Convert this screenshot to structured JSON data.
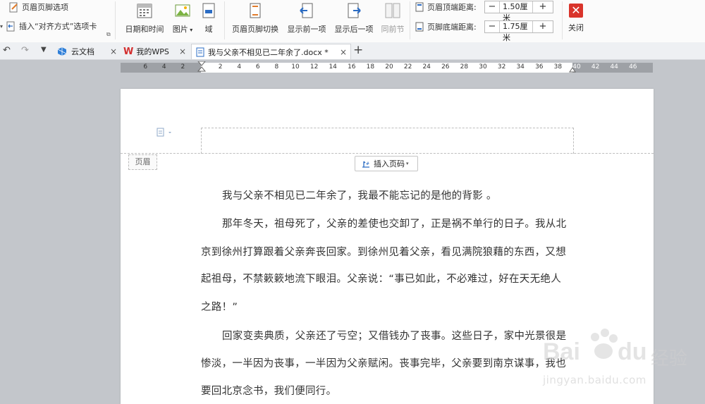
{
  "toolbar": {
    "header_footer_options": "页眉页脚选项",
    "insert_align_tab": "插入“对齐方式”选项卡",
    "date_time": "日期和时间",
    "picture": "图片",
    "field": "域",
    "hf_switch": "页眉页脚切换",
    "show_prev": "显示前一项",
    "show_next": "显示后一项",
    "same_as_prev": "同前节",
    "header_top_label": "页眉顶端距离:",
    "header_top_value": "1.50厘米",
    "footer_bottom_label": "页脚底端距离:",
    "footer_bottom_value": "1.75厘米",
    "minus": "−",
    "plus": "+",
    "close": "关闭"
  },
  "tabs": [
    {
      "label": "云文档"
    },
    {
      "label": "我的WPS"
    },
    {
      "label": "我与父亲不相见已二年余了.docx *"
    }
  ],
  "tab_close": "×",
  "new_tab": "+",
  "ruler": {
    "left": [
      "6",
      "4",
      "2"
    ],
    "right": [
      "2",
      "4",
      "6",
      "8",
      "10",
      "12",
      "14",
      "16",
      "18",
      "20",
      "22",
      "24",
      "26",
      "28",
      "30",
      "32",
      "34",
      "36",
      "38",
      "40",
      "42",
      "44",
      "46"
    ]
  },
  "header": {
    "tag": "页眉",
    "insert_page_number": "插入页码"
  },
  "body": {
    "lines": [
      "我与父亲不相见已二年余了，我最不能忘记的是他的背影  。",
      "那年冬天，祖母死了，父亲的差使也交卸了，正是祸不单行的日子。我从北",
      "京到徐州打算跟着父亲奔丧回家。到徐州见着父亲，看见满院狼藉的东西，又想",
      "起祖母，不禁簌簌地流下眼泪。父亲说：“事已如此，不必难过，好在天无绝人",
      "之路！”",
      "回家变卖典质，父亲还了亏空；又借钱办了丧事。这些日子，家中光景很是",
      "惨淡，一半因为丧事，一半因为父亲赋闲。丧事完毕，父亲要到南京谋事，我也",
      "要回北京念书，我们便同行。"
    ]
  },
  "watermark": {
    "brand": "Bai",
    "brand2": "du",
    "cn": "经验",
    "url": "jingyan.baidu.com"
  },
  "colors": {
    "accent": "#2b6cc4",
    "close_red": "#d9342b",
    "wps_red": "#d32f2f"
  }
}
